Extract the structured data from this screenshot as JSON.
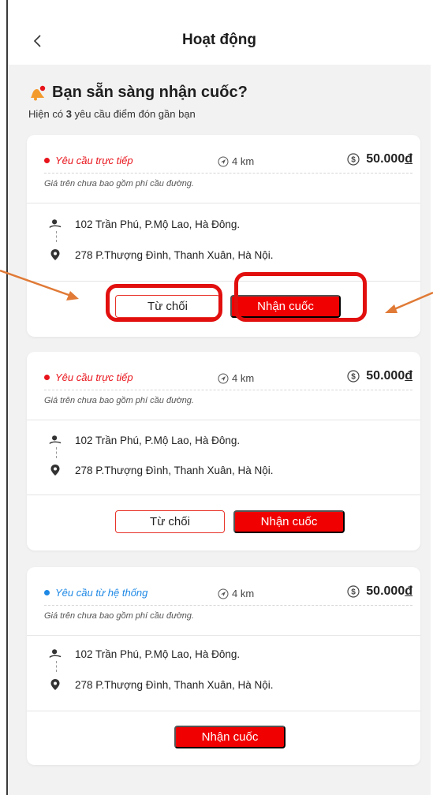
{
  "header": {
    "title": "Hoạt động"
  },
  "intro": {
    "title": "Bạn sẵn sàng nhận cuốc?",
    "sub_prefix": "Hiện có ",
    "count": "3",
    "sub_suffix": " yêu cầu điểm đón gần bạn"
  },
  "colors": {
    "accent": "#f00000",
    "direct_dot": "#e8141b",
    "system_dot": "#1e88e5"
  },
  "cards": [
    {
      "type_label": "Yêu cầu trực tiếp",
      "distance": "4 km",
      "price": "50.000",
      "currency": "đ",
      "note": "Giá trên chưa bao gồm phí cầu đường.",
      "pickup": "102 Trần Phú, P.Mộ Lao, Hà Đông.",
      "dropoff": "278 P.Thượng Đình, Thanh Xuân, Hà Nội.",
      "reject_label": "Từ chối",
      "accept_label": "Nhận cuốc"
    },
    {
      "type_label": "Yêu cầu trực tiếp",
      "distance": "4 km",
      "price": "50.000",
      "currency": "đ",
      "note": "Giá trên chưa bao gồm phí cầu đường.",
      "pickup": "102 Trần Phú, P.Mộ Lao, Hà Đông.",
      "dropoff": "278 P.Thượng Đình, Thanh Xuân, Hà Nội.",
      "reject_label": "Từ chối",
      "accept_label": "Nhận cuốc"
    },
    {
      "type_label": "Yêu cầu từ hệ thống",
      "distance": "4 km",
      "price": "50.000",
      "currency": "đ",
      "note": "Giá trên chưa bao gồm phí cầu đường.",
      "pickup": "102 Trần Phú, P.Mộ Lao, Hà Đông.",
      "dropoff": "278 P.Thượng Đình, Thanh Xuân, Hà Nội.",
      "accept_label": "Nhận cuốc"
    }
  ]
}
